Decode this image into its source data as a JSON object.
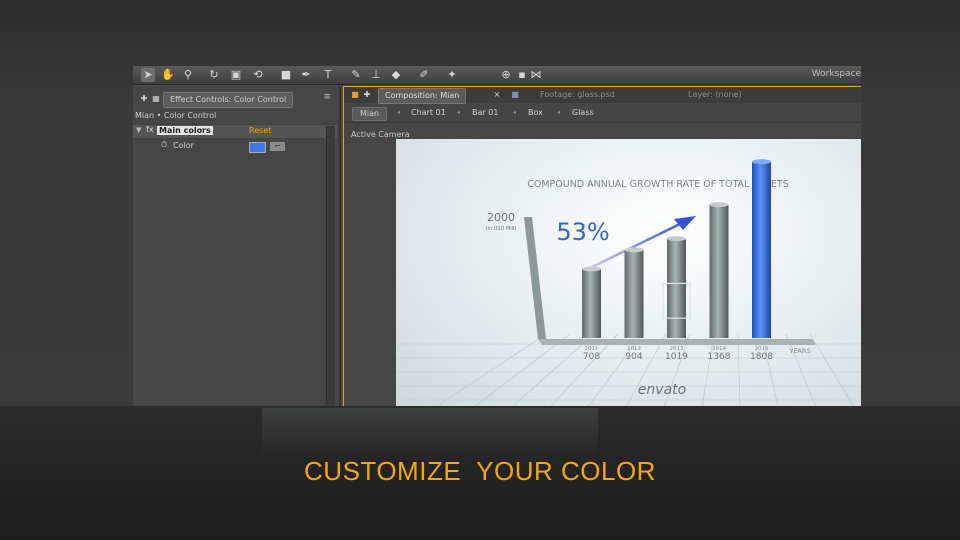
{
  "toolbar": {
    "workspace_label": "Workspace",
    "tools": [
      "selection-tool",
      "hand-tool",
      "zoom-tool",
      "rotate-tool",
      "camera-tool",
      "pan-behind-tool",
      "rectangle-tool",
      "pen-tool",
      "type-tool",
      "brush-tool",
      "clone-stamp-tool",
      "eraser-tool",
      "roto-brush-tool",
      "puppet-tool"
    ]
  },
  "effect_controls": {
    "tab_label": "Effect Controls: Color Control",
    "breadcrumb": "Mian • Color Control",
    "effect_name": "Main colors",
    "reset_label": "Reset",
    "fx_label": "fx",
    "property_label": "Color",
    "color_value": "#3c78e8"
  },
  "composition": {
    "tabs": [
      {
        "label": "Composition: Mian",
        "state": "active"
      },
      {
        "label": "Footage: glass.psd",
        "state": "inactive"
      },
      {
        "label": "Layer: (none)",
        "state": "inactive"
      }
    ],
    "breadcrumbs": [
      "Mian",
      "Chart 01",
      "Bar 01",
      "Box",
      "Glass"
    ],
    "camera_label": "Active Camera"
  },
  "chart_data": {
    "type": "bar",
    "title": "COMPOUND ANNUAL GROWTH RATE OF TOTAL ASSETS",
    "y_max_label": "2000",
    "y_unit_label": "(in USD Mill)",
    "headline": "53%",
    "xlabel": "YEARS",
    "categories": [
      "2011",
      "2012",
      "2013",
      "2014",
      "2015"
    ],
    "values": [
      708,
      904,
      1019,
      1368,
      1808
    ],
    "ylim": [
      0,
      2000
    ],
    "bar_color": "#8a9494",
    "highlight_color": "#2f6ee6",
    "highlight_index": 4
  },
  "watermark": "envato",
  "caption": "CUSTOMIZE  YOUR COLOR"
}
